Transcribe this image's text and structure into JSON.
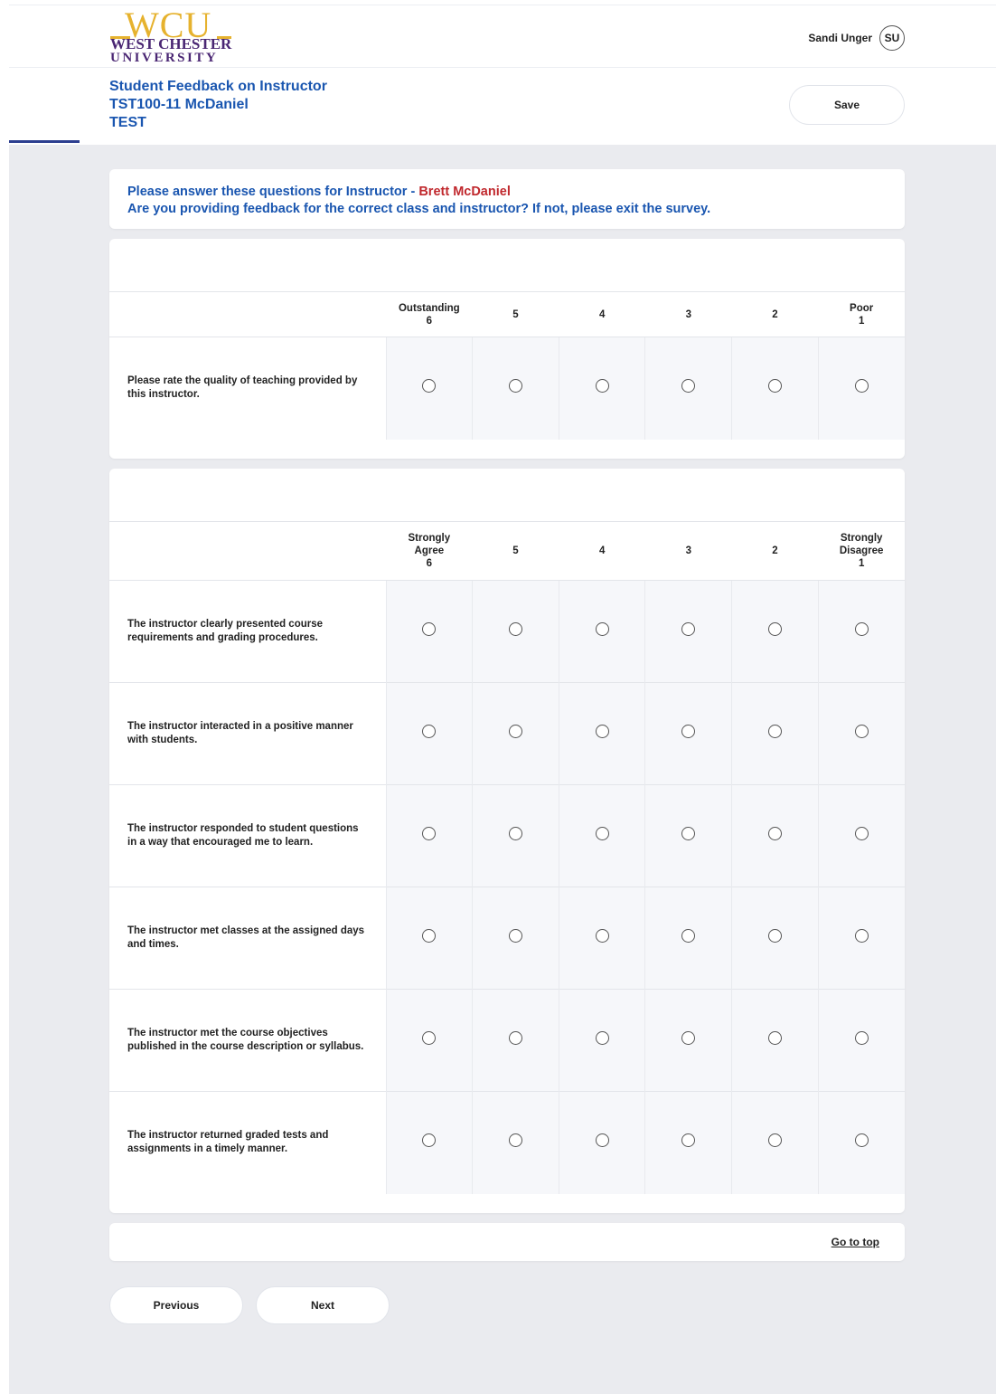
{
  "header": {
    "logo": {
      "wcu": "WCU",
      "line1": "WEST CHESTER",
      "line2": "UNIVERSITY"
    },
    "user_name": "Sandi Unger",
    "user_initials": "SU"
  },
  "survey": {
    "title": "Student Feedback on Instructor",
    "course": "TST100-11 McDaniel",
    "term": "TEST",
    "save_label": "Save"
  },
  "notice": {
    "prefix": "Please answer these questions for Instructor - ",
    "instructor": "Brett McDaniel",
    "line2": "Are you providing feedback for the correct class and instructor? If not, please exit the survey."
  },
  "section1": {
    "columns": [
      [
        "Outstanding",
        "6"
      ],
      [
        "5"
      ],
      [
        "4"
      ],
      [
        "3"
      ],
      [
        "2"
      ],
      [
        "Poor",
        "1"
      ]
    ],
    "questions": [
      "Please rate the quality of teaching provided by this instructor."
    ]
  },
  "section2": {
    "columns": [
      [
        "Strongly",
        "Agree",
        "6"
      ],
      [
        "5"
      ],
      [
        "4"
      ],
      [
        "3"
      ],
      [
        "2"
      ],
      [
        "Strongly",
        "Disagree",
        "1"
      ]
    ],
    "questions": [
      "The instructor clearly presented course requirements and grading procedures.",
      "The instructor interacted in a positive manner with students.",
      "The instructor responded to student questions in a way that encouraged me to learn.",
      "The instructor met classes at the assigned days and times.",
      "The instructor met the course objectives published in the course description or syllabus.",
      "The instructor returned graded tests and assignments in a timely manner."
    ]
  },
  "footer": {
    "go_to_top": "Go to top"
  },
  "nav": {
    "previous": "Previous",
    "next": "Next"
  }
}
